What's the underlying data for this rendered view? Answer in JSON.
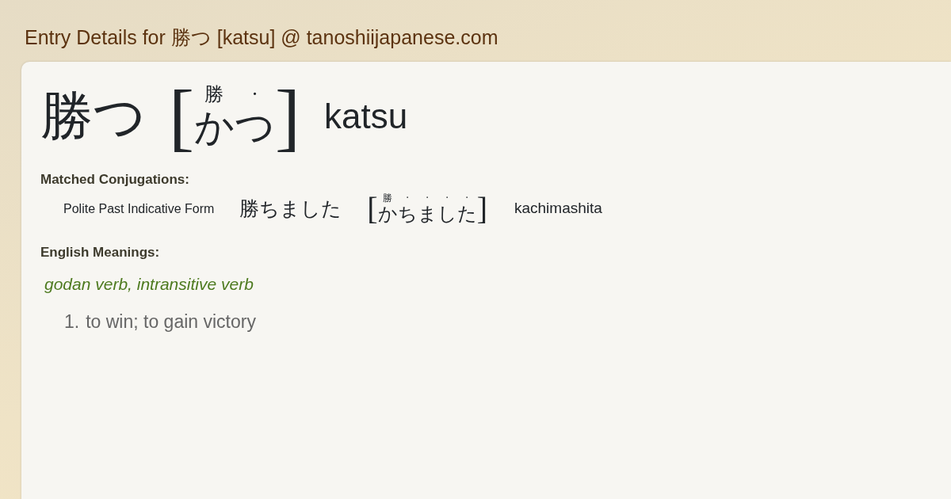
{
  "page_title": "Entry Details for 勝つ [katsu] @ tanoshiijapanese.com",
  "entry": {
    "word": "勝つ",
    "open_bracket": "[",
    "close_bracket": "]",
    "reading": [
      {
        "kana": "か",
        "above": "勝"
      },
      {
        "kana": "つ",
        "above": "·"
      }
    ],
    "romaji": "katsu"
  },
  "conjugations": {
    "heading": "Matched Conjugations:",
    "rows": [
      {
        "form": "Polite Past Indicative Form",
        "word": "勝ちました",
        "open_bracket": "[",
        "close_bracket": "]",
        "reading": [
          {
            "kana": "か",
            "above": "勝"
          },
          {
            "kana": "ち",
            "above": "·"
          },
          {
            "kana": "ま",
            "above": "·"
          },
          {
            "kana": "し",
            "above": "·"
          },
          {
            "kana": "た",
            "above": "·"
          }
        ],
        "romaji": "kachimashita"
      }
    ]
  },
  "meanings": {
    "heading": "English Meanings:",
    "part_of_speech": "godan verb, intransitive verb",
    "senses": [
      {
        "number": "1.",
        "text": "to win; to gain victory"
      }
    ]
  }
}
